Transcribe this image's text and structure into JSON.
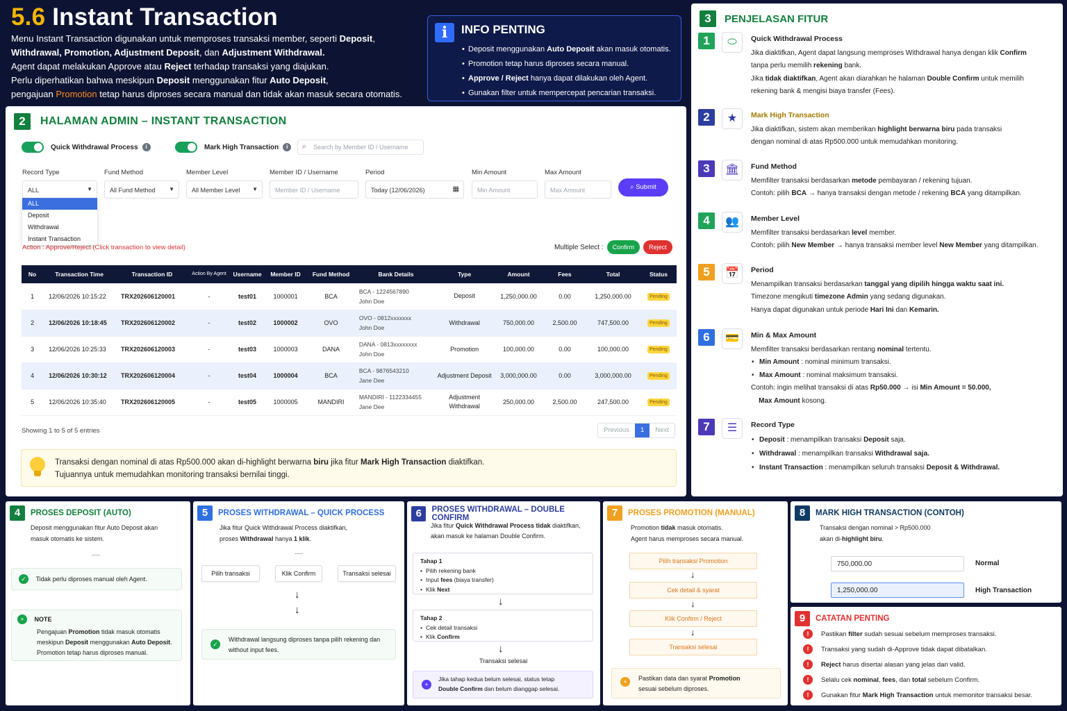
{
  "header": {
    "num": "5.6",
    "title": "Instant Transaction",
    "lines": [
      [
        {
          "t": "Menu Instant Transaction digunakan untuk memproses transaksi member, seperti "
        },
        {
          "t": "Deposit",
          "b": 1
        },
        {
          "t": ","
        }
      ],
      [
        {
          "t": "Withdrawal, Promotion, Adjustment Deposit",
          "b": 1
        },
        {
          "t": ", dan "
        },
        {
          "t": "Adjustment Withdrawal.",
          "b": 1
        }
      ],
      [
        {
          "t": "Agent dapat melakukan Approve atau "
        },
        {
          "t": "Reject",
          "b": 1
        },
        {
          "t": " terhadap transaksi yang diajukan."
        }
      ],
      [
        {
          "t": "Perlu diperhatikan bahwa meskipun "
        },
        {
          "t": "Deposit",
          "b": 1
        },
        {
          "t": " menggunakan fitur "
        },
        {
          "t": "Auto Deposit",
          "b": 1
        },
        {
          "t": ","
        }
      ],
      [
        {
          "t": "pengajuan "
        },
        {
          "t": "Promotion",
          "o": 1
        },
        {
          "t": " tetap harus diproses secara manual dan tidak akan masuk secara otomatis."
        }
      ]
    ]
  },
  "info": {
    "title": "INFO PENTING",
    "items": [
      [
        {
          "t": "Deposit menggunakan "
        },
        {
          "t": "Auto Deposit",
          "b": 1
        },
        {
          "t": " akan masuk otomatis."
        }
      ],
      [
        {
          "t": "Promotion tetap harus diproses secara manual."
        }
      ],
      [
        {
          "t": "Approve / Reject",
          "b": 1
        },
        {
          "t": " hanya dapat dilakukan oleh Agent."
        }
      ],
      [
        {
          "t": "Gunakan filter untuk mempercepat pencarian transaksi."
        }
      ]
    ]
  },
  "admin": {
    "num": "2",
    "title": "HALAMAN ADMIN – INSTANT TRANSACTION",
    "toggle1": "Quick Withdrawal Process",
    "toggle2": "Mark High Transaction",
    "search_placeholder": "Search by Member ID / Username",
    "labels": {
      "record": "Record Type",
      "fund": "Fund Method",
      "level": "Member Level",
      "member": "Member ID / Username",
      "period": "Period",
      "min": "Min Amount",
      "max": "Max Amount"
    },
    "values": {
      "record": "ALL",
      "fund": "All Fund Method",
      "level": "All Member Level",
      "member_ph": "Member ID / Username",
      "period": "Today (12/06/2026)",
      "min_ph": "Min Amount",
      "max_ph": "Max Amount"
    },
    "record_options": [
      "ALL",
      "Deposit",
      "Withdrawal",
      "Instant Transaction"
    ],
    "submit": "Submit",
    "action": "Action : Approve/Reject (Click transaction to view detail)",
    "multiple": "Multiple Select :",
    "confirm": "Confirm",
    "reject": "Reject",
    "columns": [
      "No",
      "Transaction Time",
      "Transaction ID",
      "Action By Agent",
      "Username",
      "Member ID",
      "Fund Method",
      "Bank Details",
      "Type",
      "Amount",
      "Fees",
      "Total",
      "Status"
    ],
    "rows": [
      {
        "no": "1",
        "time": "12/06/2026 10:15:22",
        "id": "TRX202606120001",
        "by": "-",
        "user": "test01",
        "mid": "1000001",
        "fund": "BCA",
        "bank": "BCA - 1224567890",
        "holder": "John Doe",
        "type": "Deposit",
        "amount": "1,250,000.00",
        "fees": "0.00",
        "total": "1,250,000.00",
        "status": "Pending",
        "hl": false
      },
      {
        "no": "2",
        "time": "12/06/2026 10:18:45",
        "id": "TRX202606120002",
        "by": "-",
        "user": "test02",
        "mid": "1000002",
        "fund": "OVO",
        "bank": "OVO - 0812xxxxxxx",
        "holder": "John Doe",
        "type": "Withdrawal",
        "amount": "750,000.00",
        "fees": "2,500.00",
        "total": "747,500.00",
        "status": "Pending",
        "hl": true
      },
      {
        "no": "3",
        "time": "12/06/2026 10:25:33",
        "id": "TRX202606120003",
        "by": "-",
        "user": "test03",
        "mid": "1000003",
        "fund": "DANA",
        "bank": "DANA - 0813xxxxxxxx",
        "holder": "John Doe",
        "type": "Promotion",
        "amount": "100,000.00",
        "fees": "0.00",
        "total": "100,000.00",
        "status": "Pending",
        "hl": false
      },
      {
        "no": "4",
        "time": "12/06/2026 10:30:12",
        "id": "TRX202606120004",
        "by": "-",
        "user": "test04",
        "mid": "1000004",
        "fund": "BCA",
        "bank": "BCA - 9876543210",
        "holder": "Jane Dee",
        "type": "Adjustment Deposit",
        "amount": "3,000,000.00",
        "fees": "0.00",
        "total": "3,000,000.00",
        "status": "Pending",
        "hl": true
      },
      {
        "no": "5",
        "time": "12/06/2026 10:35:40",
        "id": "TRX202606120005",
        "by": "-",
        "user": "test05",
        "mid": "1000005",
        "fund": "MANDIRI",
        "bank": "MANDIRI - 1122334455",
        "holder": "Jane Dee",
        "type": "Adjustment Withdrawal",
        "amount": "250,000.00",
        "fees": "2,500.00",
        "total": "247,500.00",
        "status": "Pending",
        "hl": false
      }
    ],
    "showing": "Showing 1 to 5 of 5 entries",
    "prev": "Previous",
    "page": "1",
    "next": "Next",
    "note": [
      [
        {
          "t": "Transaksi dengan nominal di atas Rp500.000 akan di-highlight berwarna "
        },
        {
          "t": "biru",
          "b": 1
        },
        {
          "t": " jika fitur "
        },
        {
          "t": "Mark High Transaction",
          "b": 1
        },
        {
          "t": " diaktifkan."
        }
      ],
      [
        {
          "t": "Tujuannya untuk memudahkan monitoring transaksi bernilai tinggi."
        }
      ]
    ]
  },
  "features": {
    "num": "3",
    "title": "PENJELASAN FITUR",
    "items": [
      {
        "n": "1",
        "color": "#22a35a",
        "icon": "toggle-icon",
        "glyph": "⬭",
        "title": "Quick Withdrawal Process",
        "lines": [
          [
            {
              "t": "Jika diaktifkan, Agent dapat langsung memproses Withdrawal hanya dengan klik "
            },
            {
              "t": "Confirm",
              "b": 1
            }
          ],
          [
            {
              "t": "tanpa perlu memilih "
            },
            {
              "t": "rekening",
              "b": 1
            },
            {
              "t": " bank."
            }
          ],
          [
            {
              "t": "Jika "
            },
            {
              "t": "tidak diaktifkan",
              "b": 1
            },
            {
              "t": ", Agent akan diarahkan he halaman "
            },
            {
              "t": "Double Confirm",
              "b": 1
            },
            {
              "t": " untuk memilih"
            }
          ],
          [
            {
              "t": "rekening bank & mengisi biaya transfer (Fees)."
            }
          ]
        ]
      },
      {
        "n": "2",
        "color": "#2c3e9e",
        "icon": "star-icon",
        "glyph": "★",
        "title": "Mark High Transaction",
        "lines": [
          [
            {
              "t": "Jika diaktifkan, sistem akan memberikan "
            },
            {
              "t": "highlight berwarna biru",
              "b": 1
            },
            {
              "t": " pada transaksi"
            }
          ],
          [
            {
              "t": "dengan nominal di atas Rp500.000 untuk memudahkan monitoring."
            }
          ]
        ]
      },
      {
        "n": "3",
        "color": "#4b39b8",
        "icon": "bank-icon",
        "glyph": "🏛",
        "title": "Fund Method",
        "lines": [
          [
            {
              "t": "Memfilter transaksi berdasarkan "
            },
            {
              "t": "metode",
              "b": 1
            },
            {
              "t": " pembayaran / rekening tujuan."
            }
          ],
          [
            {
              "t": "Contoh: pilih "
            },
            {
              "t": "BCA",
              "b": 1
            },
            {
              "t": " → hanya transaksi dengan metode / rekening "
            },
            {
              "t": "BCA",
              "b": 1
            },
            {
              "t": " yang ditampilkan."
            }
          ]
        ]
      },
      {
        "n": "4",
        "color": "#22a35a",
        "icon": "users-icon",
        "glyph": "👥",
        "title": "Member Level",
        "lines": [
          [
            {
              "t": "Memfilter transaksi berdasarkan "
            },
            {
              "t": "level",
              "b": 1
            },
            {
              "t": " member."
            }
          ],
          [
            {
              "t": "Contoh: pilih "
            },
            {
              "t": "New Member",
              "b": 1
            },
            {
              "t": " → hanya transaksi member level "
            },
            {
              "t": "New Member",
              "b": 1
            },
            {
              "t": " yang ditampilkan."
            }
          ]
        ]
      },
      {
        "n": "5",
        "color": "#f0a020",
        "icon": "calendar-icon",
        "glyph": "📅",
        "title": "Period",
        "lines": [
          [
            {
              "t": "Menampilkan transaksi berdasarkan "
            },
            {
              "t": "tanggal yang dipilih hingga waktu saat ini.",
              "b": 1
            }
          ],
          [
            {
              "t": "Timezone mengikuti "
            },
            {
              "t": "timezone Admin",
              "b": 1
            },
            {
              "t": " yang sedang digunakan."
            }
          ],
          [
            {
              "t": "Hanya dapat digunakan untuk periode "
            },
            {
              "t": "Hari Ini",
              "b": 1
            },
            {
              "t": " dan "
            },
            {
              "t": "Kemarin.",
              "b": 1
            }
          ]
        ]
      },
      {
        "n": "6",
        "color": "#2f6fe0",
        "icon": "wallet-icon",
        "glyph": "💳",
        "title": "Min & Max Amount",
        "lines": [
          [
            {
              "t": "Memfilter transaksi berdasarkan rentang "
            },
            {
              "t": "nominal",
              "b": 1
            },
            {
              "t": " tertentu."
            }
          ]
        ],
        "bullets": [
          [
            {
              "t": "Min Amount",
              "b": 1
            },
            {
              "t": " : nominal minimum transaksi."
            }
          ],
          [
            {
              "t": "Max Amount",
              "b": 1
            },
            {
              "t": " : nominal maksimum transaksi."
            }
          ]
        ],
        "after": [
          [
            {
              "t": "Contoh: ingin melihat transaksi di atas "
            },
            {
              "t": "Rp50.000",
              "b": 1
            },
            {
              "t": " → isi "
            },
            {
              "t": "Min Amount = 50.000,",
              "b": 1
            }
          ],
          [
            {
              "t": "    Max Amount",
              "b": 1
            },
            {
              "t": " kosong."
            }
          ]
        ]
      },
      {
        "n": "7",
        "color": "#4b39b8",
        "icon": "list-icon",
        "glyph": "☰",
        "title": "Record Type",
        "lines": [],
        "bullets": [
          [
            {
              "t": "Deposit",
              "b": 1
            },
            {
              "t": " : menampilkan transaksi "
            },
            {
              "t": "Deposit",
              "b": 1
            },
            {
              "t": " saja."
            }
          ],
          [
            {
              "t": "Withdrawal",
              "b": 1
            },
            {
              "t": " : menampilkan transaksi "
            },
            {
              "t": "Withdrawal saja.",
              "b": 1
            }
          ],
          [
            {
              "t": "Instant Transaction",
              "b": 1
            },
            {
              "t": " : menampilkan seluruh transaksi "
            },
            {
              "t": "Deposit & Withdrawal.",
              "b": 1
            }
          ]
        ]
      }
    ]
  },
  "p4": {
    "num": "4",
    "title": "PROSES DEPOSIT (AUTO)",
    "desc": "Deposit menggunakan fitur Auto Deposit akan masuk otomatis ke sistem.",
    "sep": "----",
    "ok": "Tidak perlu diproses manual oleh Agent.",
    "note_title": "NOTE",
    "note": [
      [
        {
          "t": "Pengajuan "
        },
        {
          "t": "Promotion",
          "b": 1
        },
        {
          "t": " tidak masuk otomatis"
        }
      ],
      [
        {
          "t": "meskipun "
        },
        {
          "t": "Deposit",
          "b": 1
        },
        {
          "t": " menggunakan "
        },
        {
          "t": "Auto Deposit",
          "b": 1
        },
        {
          "t": "."
        }
      ],
      [
        {
          "t": "Promotion tetap harus diproses manual."
        }
      ]
    ]
  },
  "p5": {
    "num": "5",
    "title": "PROSES WITHDRAWAL – QUICK PROCESS",
    "desc": [
      [
        {
          "t": "Jika fitur Quick Withdrawal Process diaktifkan,"
        }
      ],
      [
        {
          "t": "proses "
        },
        {
          "t": "Withdrawal",
          "b": 1
        },
        {
          "t": " hanya "
        },
        {
          "t": "1 klik",
          "b": 1
        },
        {
          "t": "."
        }
      ]
    ],
    "sep": "----",
    "steps": [
      "Pilih transaksi",
      "Klik Confirm",
      "Transaksi selesai"
    ],
    "ok": "Withdrawal langsung diproses tanpa pilih rekening dan without input fees."
  },
  "p6": {
    "num": "6",
    "title": "PROSES WITHDRAWAL – DOUBLE CONFIRM",
    "desc": [
      [
        {
          "t": "Jika fitur "
        },
        {
          "t": "Quick Withdrawal Process",
          "b": 1
        },
        {
          "t": " "
        },
        {
          "t": "tidak",
          "b": 1
        },
        {
          "t": " diaktifkan,"
        }
      ],
      [
        {
          "t": "akan masuk ke halaman Double Confirm."
        }
      ]
    ],
    "step1_title": "Tahap 1",
    "step1": [
      [
        {
          "t": "Pilih rekening bank"
        }
      ],
      [
        {
          "t": "Input "
        },
        {
          "t": "fees",
          "b": 1
        },
        {
          "t": " (biaya transfer)"
        }
      ],
      [
        {
          "t": "Klik "
        },
        {
          "t": "Next",
          "b": 1
        }
      ]
    ],
    "step2_title": "Tahap 2",
    "step2": [
      [
        {
          "t": "Cek detail transaksi"
        }
      ],
      [
        {
          "t": "Klik "
        },
        {
          "t": "Confirm",
          "b": 1
        }
      ]
    ],
    "done": "Transaksi selesai",
    "warn": [
      [
        {
          "t": "Jika tahap kedua belum selesai, status tetap"
        }
      ],
      [
        {
          "t": "Double Confirm",
          "b": 1
        },
        {
          "t": " dan belum dianggap selesai."
        }
      ]
    ]
  },
  "p7": {
    "num": "7",
    "title": "PROSES PROMOTION (MANUAL)",
    "desc": [
      [
        {
          "t": "Promotion "
        },
        {
          "t": "tidak",
          "b": 1
        },
        {
          "t": " masuk otomatis."
        }
      ],
      [
        {
          "t": "Agent harus memproses secara manual."
        }
      ]
    ],
    "steps": [
      "Pilih transaksi Promotion",
      "Cek detail & syarat",
      "Klik Confirm / Reject",
      "Transaksi selesai"
    ],
    "warn": [
      [
        {
          "t": "Pastikan data dan syarat "
        },
        {
          "t": "Promotion",
          "b": 1
        }
      ],
      [
        {
          "t": "sesuai sebelum diproses."
        }
      ]
    ]
  },
  "p8": {
    "num": "8",
    "title": "MARK HIGH TRANSACTION (CONTOH)",
    "desc": [
      [
        {
          "t": "Transaksi dengan nominal > Rp500.000"
        }
      ],
      [
        {
          "t": "akan di-"
        },
        {
          "t": "highlight biru",
          "b": 1
        },
        {
          "t": "."
        }
      ]
    ],
    "v1": "750,000.00",
    "l1": "Normal",
    "v2": "1,250,000.00",
    "l2": "High Transaction"
  },
  "p9": {
    "num": "9",
    "title": "CATATAN PENTING",
    "items": [
      [
        {
          "t": "Pastikan "
        },
        {
          "t": "filter",
          "b": 1
        },
        {
          "t": " sudah sesuai sebelum memproses transaksi."
        }
      ],
      [
        {
          "t": "Transaksi yang sudah di-Approve tidak dapat dibatalkan."
        }
      ],
      [
        {
          "t": "Reject",
          "b": 1
        },
        {
          "t": " harus disertai alasan yang jelas dan valid."
        }
      ],
      [
        {
          "t": "Selalu cek "
        },
        {
          "t": "nominal",
          "b": 1
        },
        {
          "t": ", "
        },
        {
          "t": "fees",
          "b": 1
        },
        {
          "t": ", dan "
        },
        {
          "t": "total",
          "b": 1
        },
        {
          "t": " sebelum Confirm."
        }
      ],
      [
        {
          "t": "Gunakan fitur "
        },
        {
          "t": "Mark High Transaction",
          "b": 1
        },
        {
          "t": " untuk memonitor transaksi besar."
        }
      ]
    ]
  },
  "colors": {
    "green": "#12803e",
    "blue_hl": "#eaf1fd",
    "orange": "#f0a020",
    "red": "#e03131",
    "purple": "#5b3df5",
    "navy": "#0d1433"
  }
}
